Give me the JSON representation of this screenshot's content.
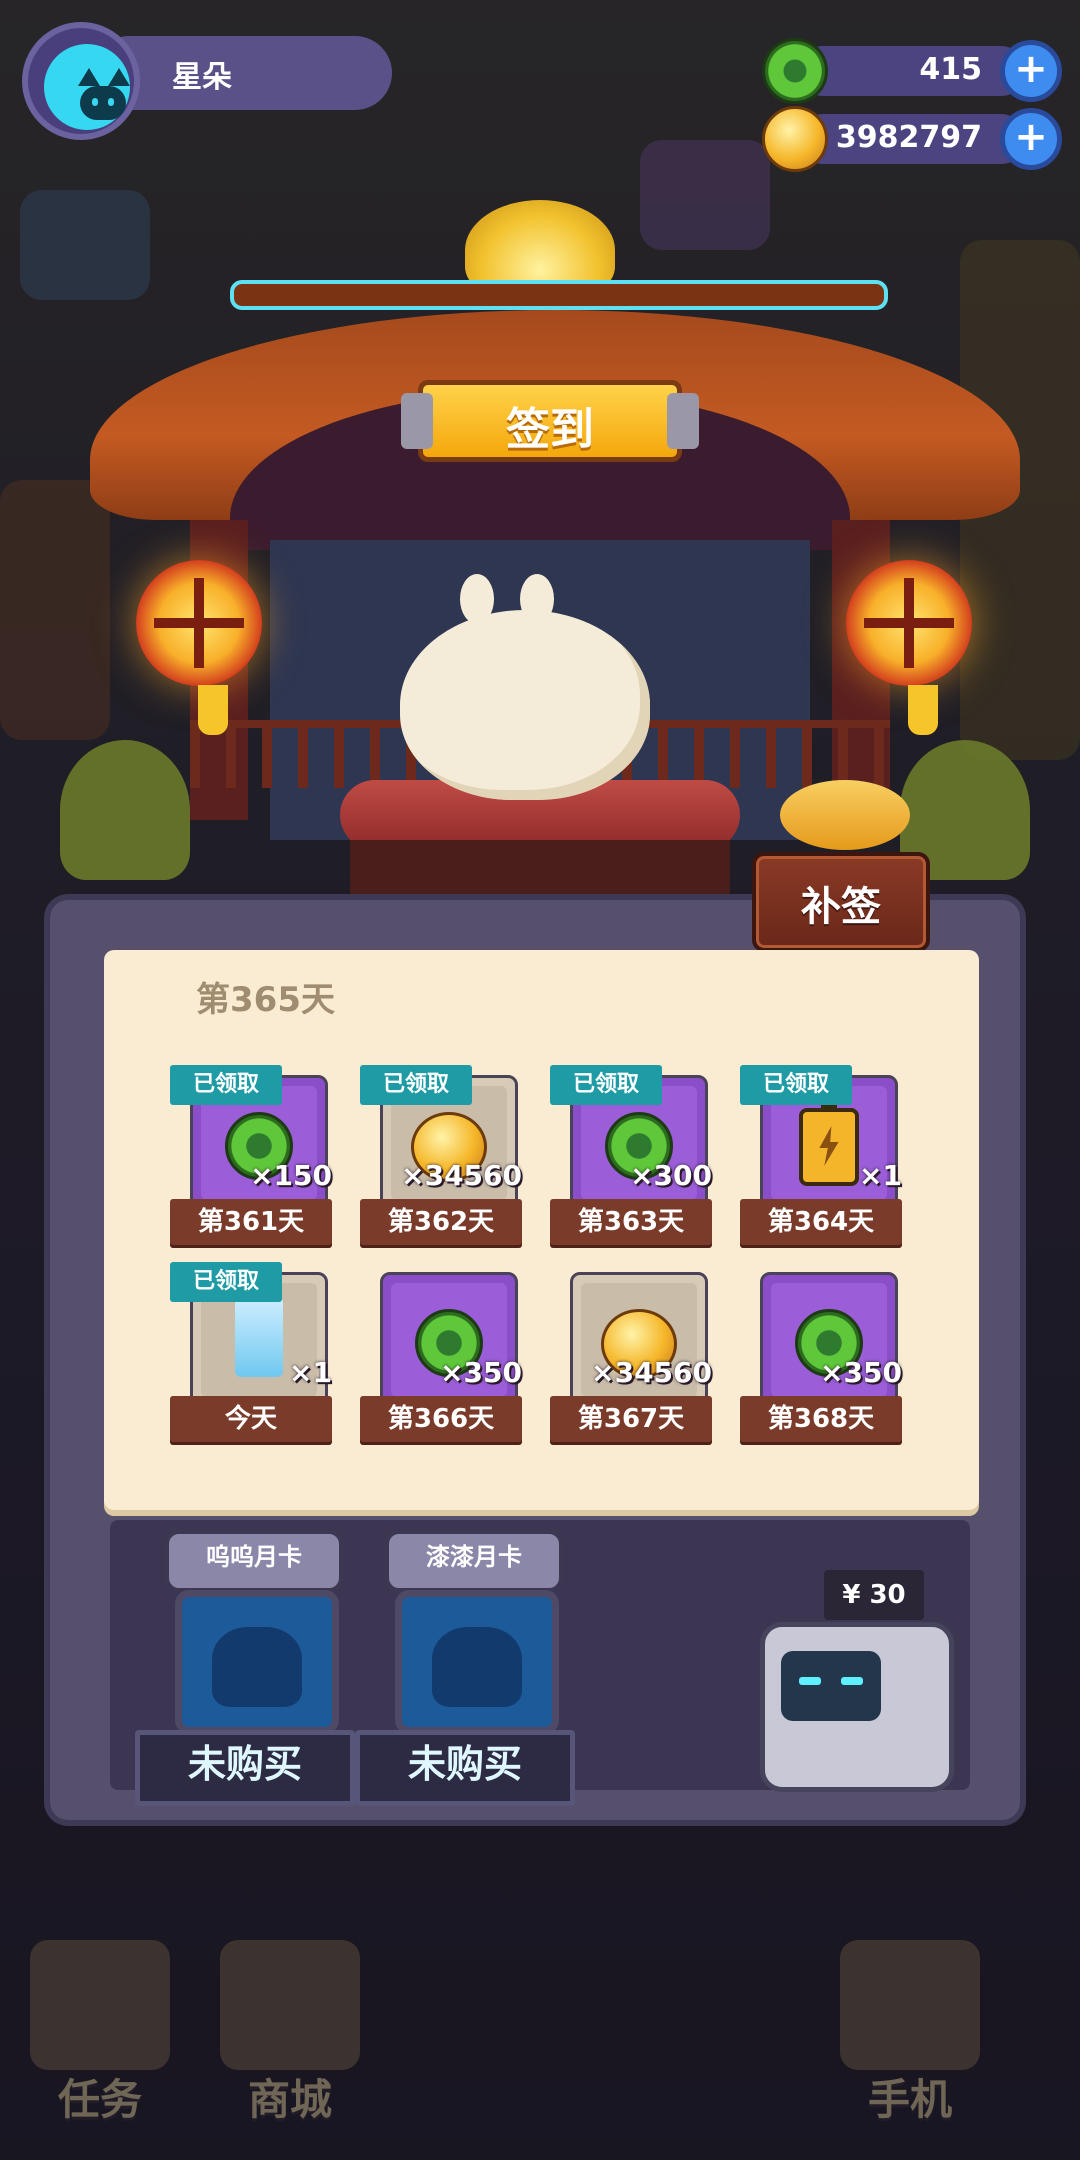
{
  "profile": {
    "name": "星朵"
  },
  "currencies": [
    {
      "icon": "green-coin-icon",
      "value": "415"
    },
    {
      "icon": "gold-coin-icon",
      "value": "3982797"
    }
  ],
  "shrine": {
    "sign": "签到",
    "resign_button": "补签"
  },
  "checkin": {
    "title": "第365天",
    "claimed_label": "已领取",
    "days": [
      {
        "label": "第361天",
        "qty": "×150",
        "icon": "green-coin-icon",
        "claimed": true,
        "frame": "purple"
      },
      {
        "label": "第362天",
        "qty": "×34560",
        "icon": "gold-coin-icon",
        "claimed": true,
        "frame": "gray"
      },
      {
        "label": "第363天",
        "qty": "×300",
        "icon": "green-coin-icon",
        "claimed": true,
        "frame": "purple"
      },
      {
        "label": "第364天",
        "qty": "×1",
        "icon": "battery-icon",
        "claimed": true,
        "frame": "purple"
      },
      {
        "label": "今天",
        "qty": "×1",
        "icon": "waterfall-icon",
        "claimed": true,
        "frame": "gray"
      },
      {
        "label": "第366天",
        "qty": "×350",
        "icon": "green-coin-icon",
        "claimed": false,
        "frame": "purple"
      },
      {
        "label": "第367天",
        "qty": "×34560",
        "icon": "gold-coin-icon",
        "claimed": false,
        "frame": "gray"
      },
      {
        "label": "第368天",
        "qty": "×350",
        "icon": "green-coin-icon",
        "claimed": false,
        "frame": "purple"
      }
    ]
  },
  "monthly_cards": [
    {
      "name": "呜呜月卡",
      "status": "未购买"
    },
    {
      "name": "漆漆月卡",
      "status": "未购买"
    }
  ],
  "vending": {
    "price": "¥ 30"
  },
  "bottom_nav": [
    "任务",
    "商城",
    "手机"
  ],
  "colors": {
    "claimed_tag": "#1f9ba5",
    "day_label": "#7a3b2a",
    "paper": "#f9ecd2",
    "plus_button": "#3f8cf0"
  }
}
